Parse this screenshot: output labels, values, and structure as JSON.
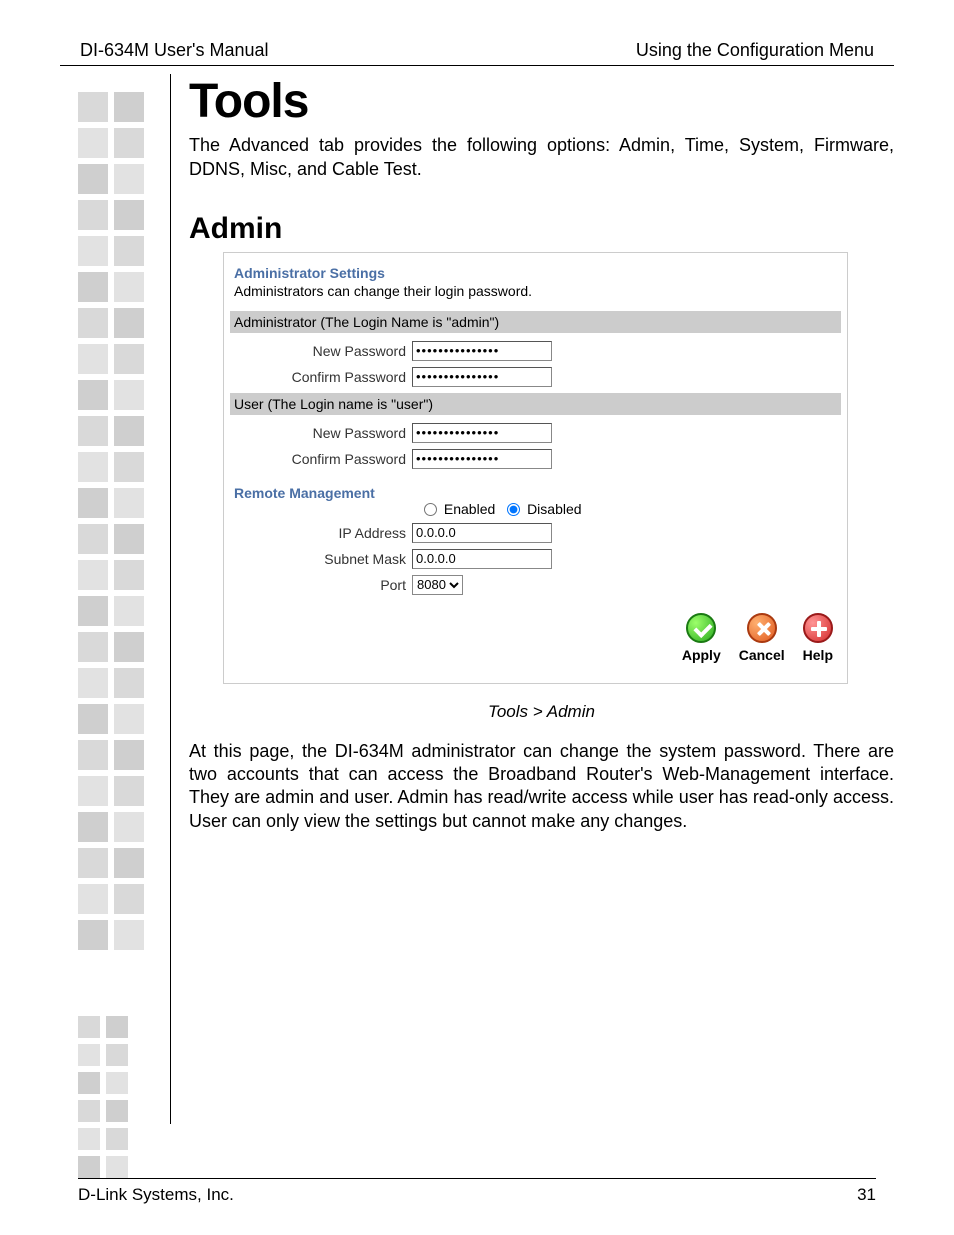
{
  "header": {
    "left": "DI-634M User's Manual",
    "right": "Using the Configuration Menu"
  },
  "section": {
    "title": "Tools",
    "intro": "The Advanced tab provides the following options: Admin, Time, System, Firmware, DDNS, Misc, and Cable Test.",
    "subtitle": "Admin"
  },
  "panel": {
    "admin_settings_title": "Administrator Settings",
    "admin_settings_desc": "Administrators can change their login password.",
    "admin_bar": "Administrator (The Login Name is \"admin\")",
    "user_bar": "User (The Login name is \"user\")",
    "labels": {
      "new_password": "New Password",
      "confirm_password": "Confirm Password",
      "ip_address": "IP Address",
      "subnet_mask": "Subnet Mask",
      "port": "Port"
    },
    "values": {
      "admin_new_pw": "•••••••••••••••",
      "admin_confirm_pw": "•••••••••••••••",
      "user_new_pw": "•••••••••••••••",
      "user_confirm_pw": "•••••••••••••••",
      "ip_address": "0.0.0.0",
      "subnet_mask": "0.0.0.0",
      "port": "8080"
    },
    "remote_title": "Remote Management",
    "radio": {
      "enabled": "Enabled",
      "disabled": "Disabled",
      "selected": "disabled"
    },
    "buttons": {
      "apply": "Apply",
      "cancel": "Cancel",
      "help": "Help"
    }
  },
  "caption": "Tools > Admin",
  "body_text": "At this page, the DI-634M administrator can change the system password. There are two accounts that can access the Broadband Router's Web-Management interface. They are admin and user. Admin has read/write access while user has read-only access. User can only view the settings but cannot make any changes.",
  "footer": {
    "left": "D-Link Systems, Inc.",
    "right": "31"
  }
}
